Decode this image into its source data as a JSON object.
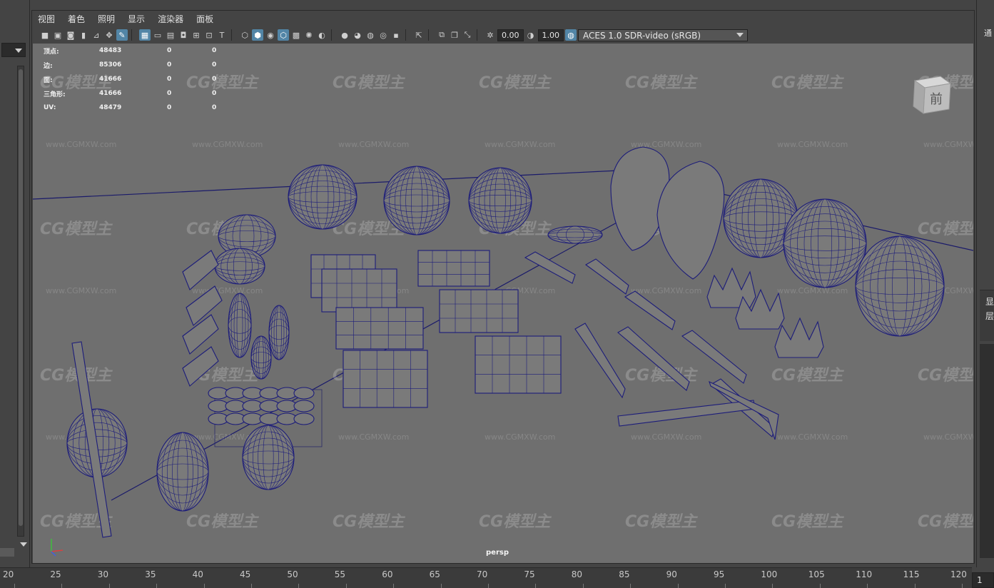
{
  "menu": [
    "视图",
    "着色",
    "照明",
    "显示",
    "渲染器",
    "面板"
  ],
  "toolbar": {
    "exposure_value": "0.00",
    "gamma_value": "1.00",
    "color_space": "ACES 1.0 SDR-video (sRGB)",
    "icons": [
      "camera-select-icon",
      "camera-attr-icon",
      "bookmark-icon",
      "image-plane-icon",
      "2d-pan-icon",
      "grease-pencil-icon",
      "grid-icon",
      "film-gate-icon",
      "resolution-gate-icon",
      "gate-mask-icon",
      "field-chart-icon",
      "safe-action-icon",
      "safe-title-icon",
      "wireframe-icon",
      "smooth-shade-icon",
      "shade-wireframe-icon",
      "bounding-box-icon",
      "textured-icon",
      "lights-icon",
      "shadows-icon",
      "ssao-icon",
      "motion-blur-icon",
      "aa-icon",
      "dof-icon",
      "isolate-icon",
      "xray-icon",
      "xray-joints-icon",
      "xray-components-icon",
      "exposure-icon",
      "gamma-icon",
      "color-mgmt-icon"
    ]
  },
  "hud": [
    {
      "label": "顶点:",
      "v1": "48483",
      "v2": "0",
      "v3": "0"
    },
    {
      "label": "边:",
      "v1": "85306",
      "v2": "0",
      "v3": "0"
    },
    {
      "label": "面:",
      "v1": "41666",
      "v2": "0",
      "v3": "0"
    },
    {
      "label": "三角形:",
      "v1": "41666",
      "v2": "0",
      "v3": "0"
    },
    {
      "label": "UV:",
      "v1": "48479",
      "v2": "0",
      "v3": "0"
    }
  ],
  "viewport": {
    "camera_name": "persp",
    "viewcube_face": "前",
    "watermark_logo": "CG模型主",
    "watermark_url": "www.CGMXW.com"
  },
  "right_panel": {
    "label_top": "通",
    "label_mid_1": "显",
    "label_mid_2": "层"
  },
  "timeline": {
    "ticks": [
      "20",
      "25",
      "30",
      "35",
      "40",
      "45",
      "50",
      "55",
      "60",
      "65",
      "70",
      "75",
      "80",
      "85",
      "90",
      "95",
      "100",
      "105",
      "110",
      "115",
      "120"
    ],
    "current_frame": "1"
  },
  "colors": {
    "viewport_bg": "#6f6f6f",
    "wireframe": "#1c1c7a",
    "ui_bg": "#444444",
    "highlight": "#5285a6"
  }
}
